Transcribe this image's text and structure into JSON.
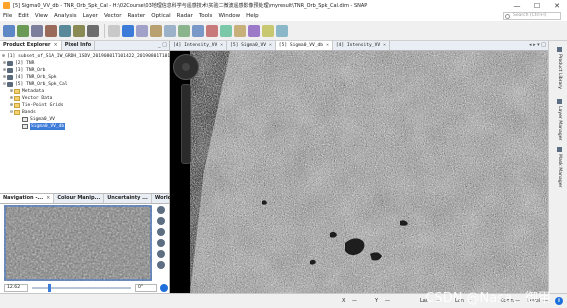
{
  "window": {
    "title": "[5] Sigma0_VV_db - TNR_Orb_Spk_Cal - H:\\02Course\\03地理信息科学与遥感技术\\实验二微波遥感影像预处理\\myresult\\TNR_Orb_Spk_Cal.dim - SNAP",
    "minimize": "—",
    "maximize": "☐",
    "close": "✕"
  },
  "menu": {
    "items": [
      "File",
      "Edit",
      "View",
      "Analysis",
      "Layer",
      "Vector",
      "Raster",
      "Optical",
      "Radar",
      "Tools",
      "Window",
      "Help"
    ],
    "search_placeholder": "Search (Ctrl+I)"
  },
  "product_explorer": {
    "tabs": [
      {
        "label": "Product Explorer",
        "close": "×"
      },
      {
        "label": "Pixel Info",
        "close": ""
      }
    ],
    "controls": "_ □",
    "tree": [
      {
        "toggle": "⊕",
        "label": "[1]  subset_of_S1A_IW_GRDH_1SDV_20190801T101422_20190801T101447_028390_0334F2_TNR_Orb_Spk_Cal",
        "type": "prod",
        "depth": 0
      },
      {
        "toggle": "⊕",
        "label": "[2]  TNR",
        "type": "prod",
        "depth": 0
      },
      {
        "toggle": "⊕",
        "label": "[3]  TNR_Orb",
        "type": "prod",
        "depth": 0
      },
      {
        "toggle": "⊕",
        "label": "[4]  TNR_Orb_Spk",
        "type": "prod",
        "depth": 0
      },
      {
        "toggle": "⊖",
        "label": "[5]  TNR_Orb_Spk_Cal",
        "type": "prod",
        "depth": 0
      },
      {
        "toggle": "⊕",
        "label": "Metadata",
        "type": "fold",
        "depth": 1
      },
      {
        "toggle": "⊕",
        "label": "Vector Data",
        "type": "fold",
        "depth": 1
      },
      {
        "toggle": "⊕",
        "label": "Tie-Point Grids",
        "type": "fold",
        "depth": 1
      },
      {
        "toggle": "⊖",
        "label": "Bands",
        "type": "fold",
        "depth": 1
      },
      {
        "toggle": "",
        "label": "Sigma0_VV",
        "type": "band",
        "depth": 2
      },
      {
        "toggle": "",
        "label": "Sigma0_VV_db",
        "type": "band",
        "depth": 2,
        "selected": true
      }
    ]
  },
  "navigation": {
    "tabs": [
      {
        "label": "Navigation -...",
        "close": "×"
      },
      {
        "label": "Colour Manip...",
        "close": ""
      },
      {
        "label": "Uncertainty ...",
        "close": ""
      },
      {
        "label": "World View",
        "close": ""
      }
    ],
    "zoom_value": "12.62",
    "rotation_value": "0°"
  },
  "image_tabs": [
    {
      "label": "[4] Intensity_VV",
      "close": "×"
    },
    {
      "label": "[5] Sigma0_VV",
      "close": "×"
    },
    {
      "label": "[5] Sigma0_VV_db",
      "close": "×"
    },
    {
      "label": "[4] Intensity_VV",
      "close": "×"
    }
  ],
  "image_tab_controls": "◂ ▸ ▾ □",
  "right_panels": [
    "Product Library",
    "Layer Manager",
    "Mask Manager"
  ],
  "status": {
    "x": "X",
    "y": "Y",
    "lat": "Lat",
    "lon": "Lon",
    "zoom": "Zoom",
    "level": "Level",
    "dashes": "—",
    "info": "i"
  },
  "watermark": "CSDN @Nasa、御甲",
  "colors": {
    "selection": "#3d7bd9",
    "tab_active": "#ffffff"
  }
}
